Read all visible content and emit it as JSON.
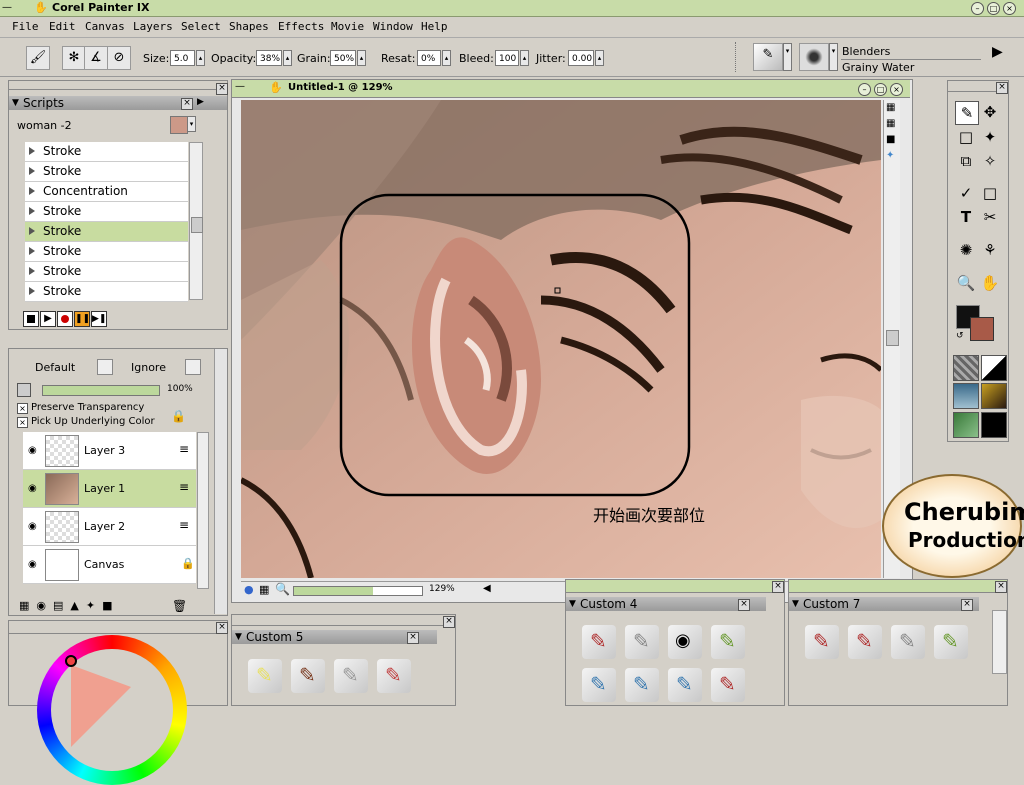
{
  "app": {
    "title": "Corel Painter IX"
  },
  "menu": [
    "File",
    "Edit",
    "Canvas",
    "Layers",
    "Select",
    "Shapes",
    "Effects",
    "Movie",
    "Window",
    "Help"
  ],
  "propbar": {
    "size_label": "Size:",
    "size_value": "5.0",
    "opacity_label": "Opacity:",
    "opacity_value": "38%",
    "grain_label": "Grain:",
    "grain_value": "50%",
    "resat_label": "Resat:",
    "resat_value": "0%",
    "bleed_label": "Bleed:",
    "bleed_value": "100",
    "jitter_label": "Jitter:",
    "jitter_value": "0.00",
    "brush_category": "Blenders",
    "brush_variant": "Grainy Water"
  },
  "scripts": {
    "title": "Scripts",
    "current": "woman -2",
    "items": [
      "Stroke",
      "Stroke",
      "Concentration",
      "Stroke",
      "Stroke",
      "Stroke",
      "Stroke",
      "Stroke"
    ],
    "selected_index": 4
  },
  "layers": {
    "composite_method": "Default",
    "depth": "Ignore",
    "opacity": "100%",
    "preserve_transparency": "Preserve Transparency",
    "pick_up_color": "Pick Up Underlying Color",
    "items": [
      "Layer 3",
      "Layer 1",
      "Layer 2",
      "Canvas"
    ],
    "selected_index": 1
  },
  "document": {
    "title": "Untitled-1 @ 129%",
    "zoom": "129%",
    "caption": "开始画次要部位"
  },
  "palettes": {
    "custom5": "Custom  5",
    "custom4": "Custom  4",
    "custom7": "Custom  7"
  },
  "watermark": {
    "line1": "Cherubim",
    "line2": "Production"
  },
  "colors": {
    "primary": "#111111",
    "secondary": "#a85a48",
    "accent": "#c8dca8"
  }
}
